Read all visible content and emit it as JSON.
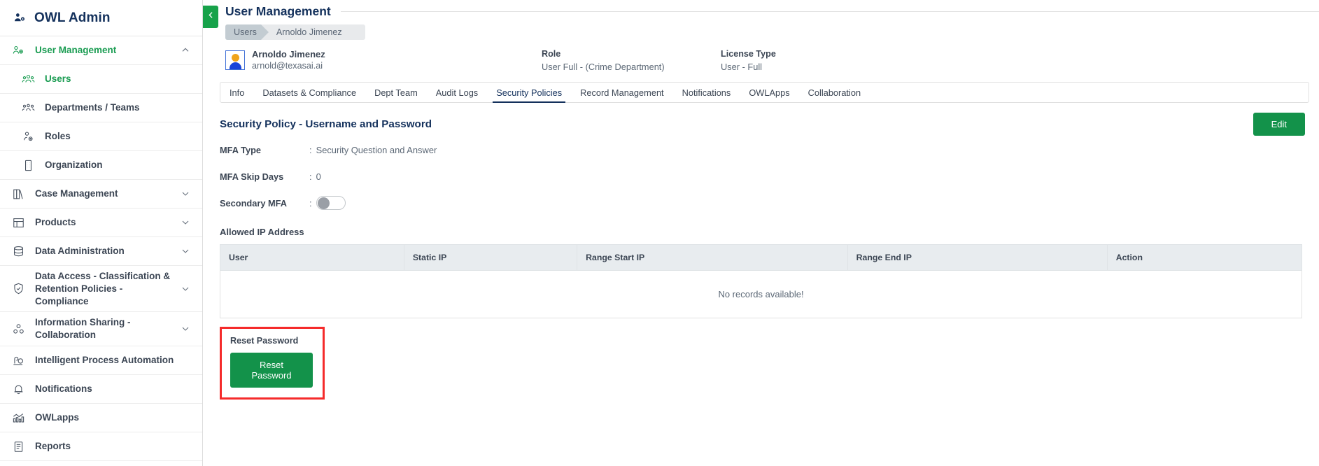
{
  "brand": {
    "title": "OWL Admin",
    "icon": "users-gear-icon"
  },
  "sidebar": {
    "items": [
      {
        "label": "User Management",
        "icon": "users-gear-icon",
        "expandable": true,
        "expanded": true,
        "active": true,
        "child": false
      },
      {
        "label": "Users",
        "icon": "users-icon",
        "expandable": false,
        "expanded": false,
        "active": true,
        "child": true
      },
      {
        "label": "Departments / Teams",
        "icon": "group-people-icon",
        "expandable": false,
        "expanded": false,
        "active": false,
        "child": true
      },
      {
        "label": "Roles",
        "icon": "person-gear-icon",
        "expandable": false,
        "expanded": false,
        "active": false,
        "child": true
      },
      {
        "label": "Organization",
        "icon": "building-icon",
        "expandable": false,
        "expanded": false,
        "active": false,
        "child": true
      },
      {
        "label": "Case Management",
        "icon": "books-icon",
        "expandable": true,
        "expanded": false,
        "active": false,
        "child": false
      },
      {
        "label": "Products",
        "icon": "layout-icon",
        "expandable": true,
        "expanded": false,
        "active": false,
        "child": false
      },
      {
        "label": "Data Administration",
        "icon": "database-icon",
        "expandable": true,
        "expanded": false,
        "active": false,
        "child": false
      },
      {
        "label": "Data Access - Classification & Retention Policies - Compliance",
        "icon": "shield-check-icon",
        "expandable": true,
        "expanded": false,
        "active": false,
        "child": false
      },
      {
        "label": "Information Sharing - Collaboration",
        "icon": "share-nodes-icon",
        "expandable": true,
        "expanded": false,
        "active": false,
        "child": false
      },
      {
        "label": "Intelligent Process Automation",
        "icon": "automation-icon",
        "expandable": false,
        "expanded": false,
        "active": false,
        "child": false
      },
      {
        "label": "Notifications",
        "icon": "bell-icon",
        "expandable": false,
        "expanded": false,
        "active": false,
        "child": false
      },
      {
        "label": "OWLapps",
        "icon": "chart-apps-icon",
        "expandable": false,
        "expanded": false,
        "active": false,
        "child": false
      },
      {
        "label": "Reports",
        "icon": "report-document-icon",
        "expandable": false,
        "expanded": false,
        "active": false,
        "child": false
      }
    ]
  },
  "header": {
    "page_title": "User Management",
    "collapse_icon": "chevron-left-icon",
    "breadcrumb": {
      "first": "Users",
      "second": "Arnoldo Jimenez"
    },
    "user": {
      "name": "Arnoldo Jimenez",
      "email": "arnold@texasai.ai"
    },
    "role": {
      "label": "Role",
      "value": "User Full - (Crime Department)"
    },
    "license": {
      "label": "License Type",
      "value": "User - Full"
    }
  },
  "tabs": [
    {
      "label": "Info",
      "active": false
    },
    {
      "label": "Datasets & Compliance",
      "active": false
    },
    {
      "label": "Dept Team",
      "active": false
    },
    {
      "label": "Audit Logs",
      "active": false
    },
    {
      "label": "Security Policies",
      "active": true
    },
    {
      "label": "Record Management",
      "active": false
    },
    {
      "label": "Notifications",
      "active": false
    },
    {
      "label": "OWLApps",
      "active": false
    },
    {
      "label": "Collaboration",
      "active": false
    }
  ],
  "main": {
    "section_title": "Security Policy - Username and Password",
    "edit_label": "Edit",
    "fields": [
      {
        "label": "MFA Type",
        "colon": ":",
        "value": "Security Question and Answer",
        "type": "text"
      },
      {
        "label": "MFA Skip Days",
        "colon": ":",
        "value": "0",
        "type": "text"
      },
      {
        "label": "Secondary MFA",
        "colon": ":",
        "value": "off",
        "type": "toggle"
      }
    ],
    "allowed_ip_heading": "Allowed IP Address",
    "table": {
      "columns": [
        "User",
        "Static IP",
        "Range Start IP",
        "Range End IP",
        "Action"
      ],
      "rows": [],
      "empty_message": "No records available!"
    },
    "reset": {
      "label": "Reset Password",
      "button": "Reset Password",
      "highlight_color": "#f52b2b"
    }
  },
  "colors": {
    "brand_navy": "#14315c",
    "accent_green": "#13924a",
    "active_green": "#1a9c52",
    "text_gray": "#5c6876",
    "table_header_bg": "#e8ecef"
  }
}
